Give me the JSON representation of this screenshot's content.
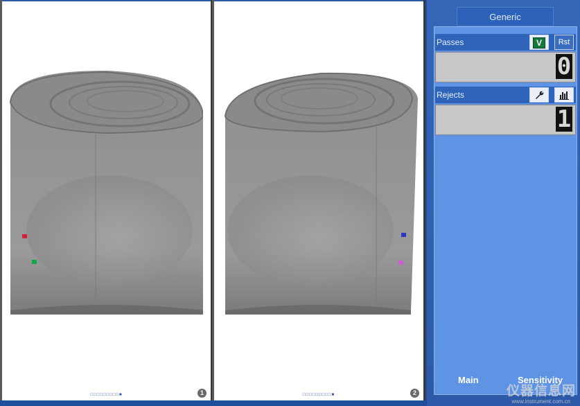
{
  "views": [
    {
      "page_number": "1",
      "markers": [
        "#d0203c",
        "#0ea847"
      ],
      "page_dots": "□□□□□□□□□■"
    },
    {
      "page_number": "2",
      "markers": [
        "#2c35c8",
        "#d35ad8"
      ],
      "page_dots": "□□□□□□□□□■"
    }
  ],
  "panel": {
    "tab_label": "Generic",
    "passes": {
      "label": "Passes",
      "verify_button": "V",
      "reset_button": "Rst",
      "count": "0"
    },
    "rejects": {
      "label": "Rejects",
      "wrench_icon": "wrench-icon",
      "chart_icon": "bar-chart-icon",
      "count": "1"
    },
    "bottom_tabs": {
      "main": "Main",
      "sensitivity": "Sensitivity"
    },
    "watermark": {
      "text": "仪器信息网",
      "url": "www.instrument.com.cn"
    }
  }
}
